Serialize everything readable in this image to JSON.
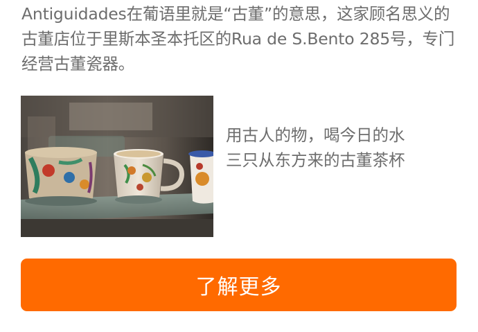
{
  "article": {
    "intro": "Antiguidades在葡语里就是“古董”的意思，这家顾名思义的古董店位于里斯本圣本托区的Rua de S.Bento 285号，专门经营古董瓷器。"
  },
  "feature": {
    "caption_line1": "用古人的物，喝今日的水",
    "caption_line2": "三只从东方来的古董茶杯"
  },
  "cta": {
    "label": "了解更多",
    "color": "#ff6a00"
  }
}
